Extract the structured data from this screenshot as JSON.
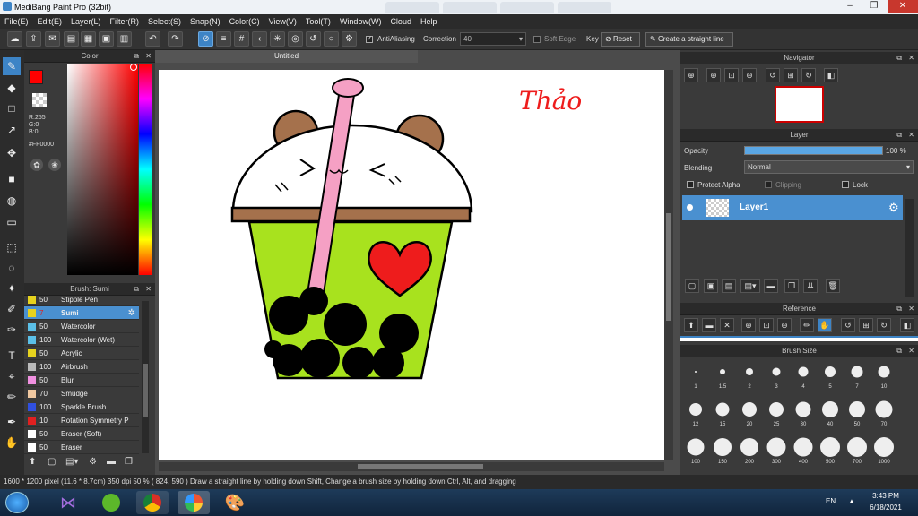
{
  "window": {
    "title": "MediBang Paint Pro (32bit)",
    "document_tab": "Untitled"
  },
  "menu": [
    "File(E)",
    "Edit(E)",
    "Layer(L)",
    "Filter(R)",
    "Select(S)",
    "Snap(N)",
    "Color(C)",
    "View(V)",
    "Tool(T)",
    "Window(W)",
    "Cloud",
    "Help"
  ],
  "toolbar": {
    "antialiasing_label": "AntiAliasing",
    "correction_label": "Correction",
    "correction_value": "40",
    "soft_edge_label": "Soft Edge",
    "key_label": "Key",
    "reset_label": "Reset",
    "create_line_label": "Create a straight line"
  },
  "color": {
    "title": "Color",
    "r": "R:255",
    "g": "G:0",
    "b": "B:0",
    "hex": "#FF0000",
    "primary": "#ff0000"
  },
  "brush": {
    "title": "Brush: Sumi",
    "items": [
      {
        "size": "50",
        "name": "Stipple Pen",
        "color": "#e6d21e"
      },
      {
        "size": "7",
        "name": "Sumi",
        "color": "#e6d21e",
        "selected": true
      },
      {
        "size": "50",
        "name": "Watercolor",
        "color": "#5bc0e8"
      },
      {
        "size": "100",
        "name": "Watercolor (Wet)",
        "color": "#5bc0e8"
      },
      {
        "size": "50",
        "name": "Acrylic",
        "color": "#e6d21e"
      },
      {
        "size": "100",
        "name": "Airbrush",
        "color": "#bbbbbb"
      },
      {
        "size": "50",
        "name": "Blur",
        "color": "#f090e0"
      },
      {
        "size": "70",
        "name": "Smudge",
        "color": "#f0c8a0"
      },
      {
        "size": "100",
        "name": "Sparkle Brush",
        "color": "#3050e0"
      },
      {
        "size": "10",
        "name": "Rotation Symmetry P",
        "color": "#e02020"
      },
      {
        "size": "50",
        "name": "Eraser (Soft)",
        "color": "#ffffff"
      },
      {
        "size": "50",
        "name": "Eraser",
        "color": "#ffffff"
      }
    ]
  },
  "canvas": {
    "signature": "Thảo"
  },
  "navigator": {
    "title": "Navigator"
  },
  "layer": {
    "title": "Layer",
    "opacity_label": "Opacity",
    "opacity_value": "100 %",
    "opacity_level": 1.0,
    "blending_label": "Blending",
    "blending_value": "Normal",
    "protect_alpha": "Protect Alpha",
    "clipping": "Clipping",
    "lock": "Lock",
    "layer_name": "Layer1"
  },
  "reference": {
    "title": "Reference"
  },
  "brush_size": {
    "title": "Brush Size",
    "sizes": [
      "1",
      "1.5",
      "2",
      "3",
      "4",
      "5",
      "7",
      "10",
      "12",
      "15",
      "20",
      "25",
      "30",
      "40",
      "50",
      "70",
      "100",
      "150",
      "200",
      "300",
      "400",
      "500",
      "700",
      "1000"
    ]
  },
  "status": {
    "text": "1600 * 1200 pixel  (11.6 * 8.7cm)  350 dpi  50 %  ( 824, 590 )  Draw a straight line by holding down Shift, Change a brush size by holding down Ctrl, Alt, and dragging"
  },
  "taskbar": {
    "lang": "EN",
    "time": "3:43 PM",
    "date": "6/18/2021"
  }
}
